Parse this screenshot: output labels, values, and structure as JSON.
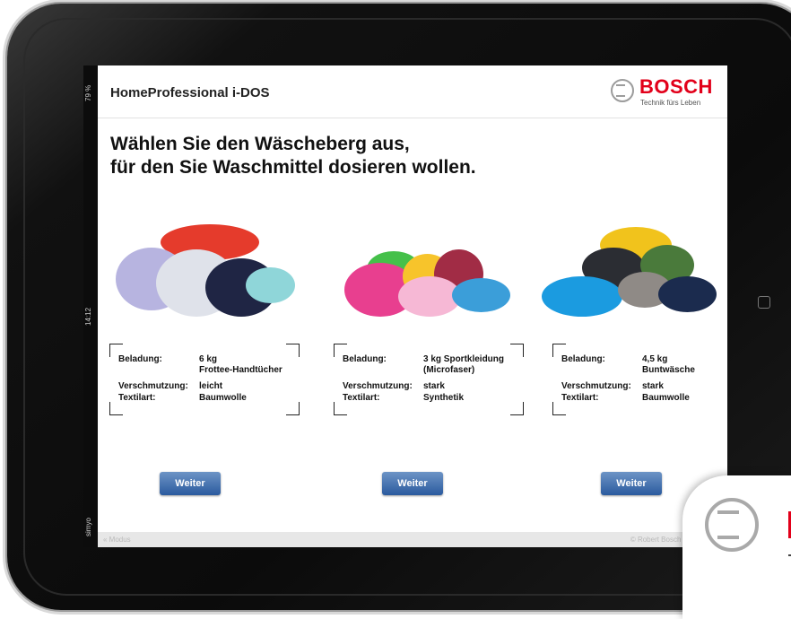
{
  "status_bar": {
    "battery": "79 %",
    "time": "14:12",
    "carrier": "simyo"
  },
  "header": {
    "app_title": "HomeProfessional i-DOS",
    "brand": "BOSCH",
    "slogan": "Technik fürs Leben"
  },
  "headline": {
    "line1": "Wählen Sie den Wäscheberg aus,",
    "line2": "für den Sie Waschmittel dosieren wollen."
  },
  "labels": {
    "load": "Beladung:",
    "soiling": "Verschmutzung:",
    "textile": "Textilart:"
  },
  "options": [
    {
      "load_line1": "6 kg",
      "load_line2": "Frottee-Handtücher",
      "soiling": "leicht",
      "textile": "Baumwolle",
      "button": "Weiter"
    },
    {
      "load_line1": "3 kg Sportkleidung",
      "load_line2": "(Microfaser)",
      "soiling": "stark",
      "textile": "Synthetik",
      "button": "Weiter"
    },
    {
      "load_line1": "4,5 kg",
      "load_line2": "Buntwäsche",
      "soiling": "stark",
      "textile": "Baumwolle",
      "button": "Weiter"
    }
  ],
  "footer": {
    "left": "« Modus",
    "right": "© Robert Bosch Hausgeräte"
  },
  "colors": {
    "brand_red": "#e2001a",
    "button_blue": "#2a5a9e"
  }
}
